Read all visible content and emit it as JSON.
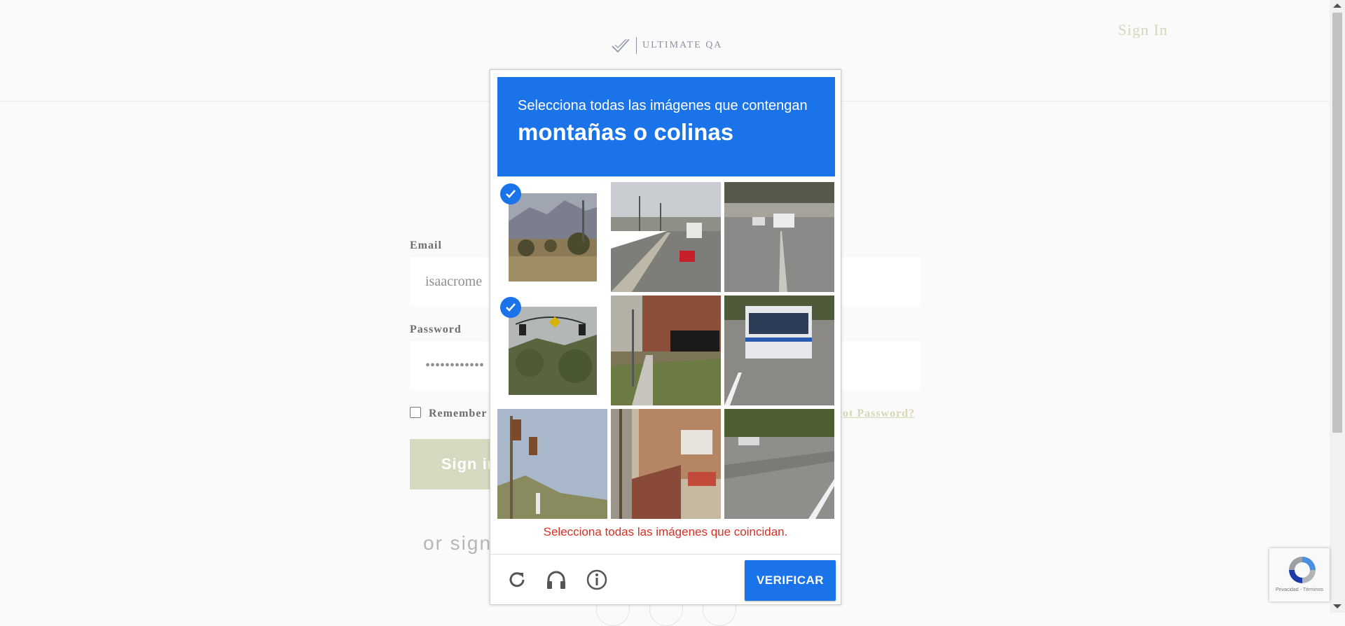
{
  "header": {
    "logo_text": "ULTIMATE QA",
    "sign_in_label": "Sign In"
  },
  "form": {
    "email_label": "Email",
    "email_value": "isaacrome",
    "password_label": "Password",
    "password_value": "••••••••••••",
    "remember_label": "Remember",
    "forgot_label": "got Password?",
    "sign_in_button": "Sign in",
    "or_sign_text": "or sign"
  },
  "captcha": {
    "instruction": "Selecciona todas las imágenes que contengan",
    "target": "montañas o colinas",
    "error_message": "Selecciona todas las imágenes que coincidan.",
    "verify_label": "VERIFICAR",
    "header_color": "#1a73e8",
    "tiles": [
      {
        "content": "mountains-landscape",
        "selected": true
      },
      {
        "content": "highway-cars",
        "selected": false
      },
      {
        "content": "street-cars",
        "selected": false
      },
      {
        "content": "traffic-light-hills",
        "selected": true
      },
      {
        "content": "sidewalk-car",
        "selected": false
      },
      {
        "content": "city-bus",
        "selected": false
      },
      {
        "content": "traffic-light-sky",
        "selected": false
      },
      {
        "content": "house-stairs",
        "selected": false
      },
      {
        "content": "suburban-road",
        "selected": false
      }
    ],
    "icons": [
      "reload-icon",
      "audio-icon",
      "info-icon"
    ]
  },
  "recaptcha_badge": {
    "text": "Privacidad - Términos"
  }
}
